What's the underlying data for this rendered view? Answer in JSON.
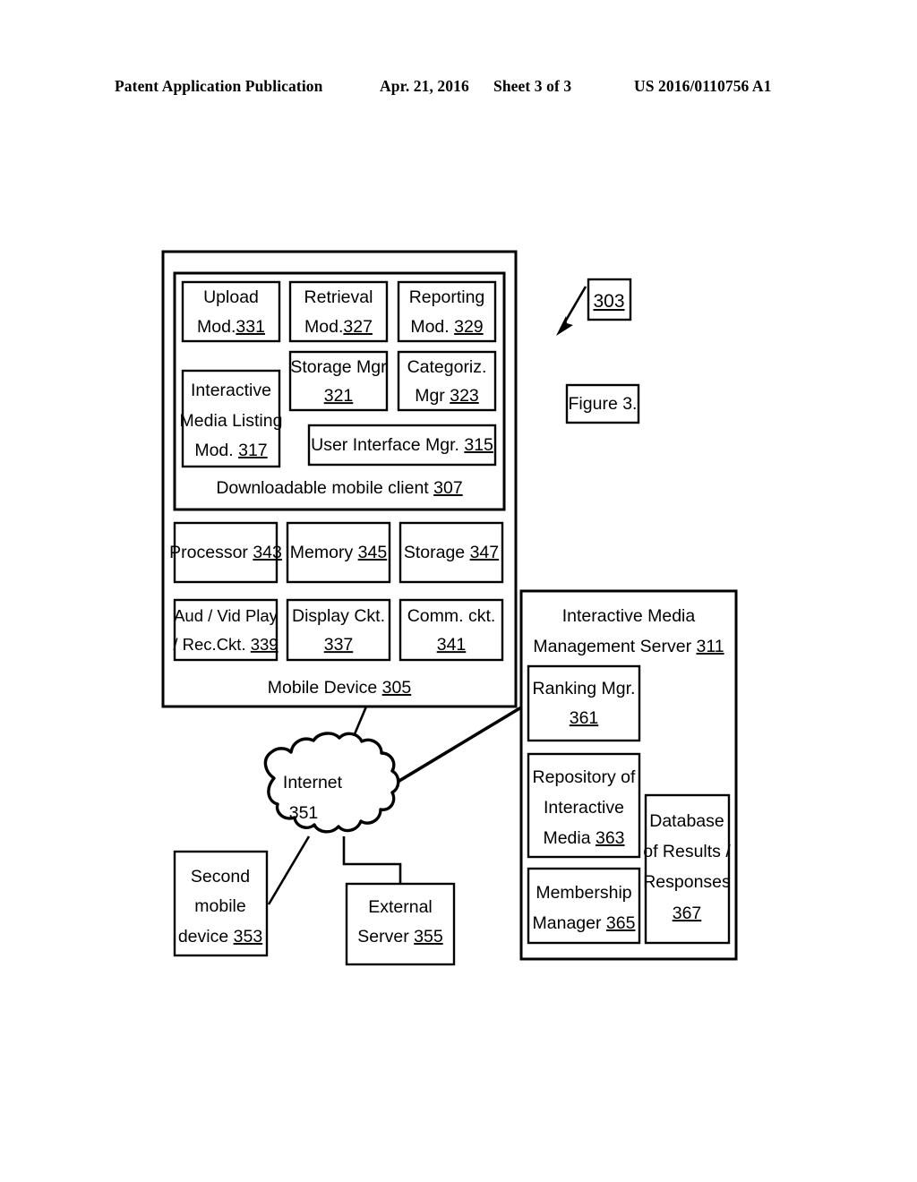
{
  "header": {
    "title": "Patent Application Publication",
    "date": "Apr. 21, 2016",
    "sheet": "Sheet 3 of 3",
    "number": "US 2016/0110756 A1"
  },
  "figure": {
    "reference_label": "303",
    "caption": "Figure 3."
  },
  "diagram": {
    "mobile_device": {
      "label_text": "Mobile Device",
      "label_num": "305",
      "client": {
        "label_text": "Downloadable mobile client",
        "label_num": "307",
        "modules": [
          {
            "line1": "Upload",
            "line2_text": "Mod.",
            "line2_num": "331"
          },
          {
            "line1": "Retrieval",
            "line2_text": "Mod.",
            "line2_num": "327"
          },
          {
            "line1": "Reporting",
            "line2_text": "Mod. ",
            "line2_num": "329"
          },
          {
            "line1": "Storage Mgr",
            "line2_text": "",
            "line2_num": "321"
          },
          {
            "line1": "Categoriz.",
            "line2_text": "Mgr ",
            "line2_num": "323"
          }
        ],
        "media_listing": {
          "line1": "Interactive",
          "line2": "Media Listing",
          "line3_text": "Mod. ",
          "line3_num": "317"
        },
        "user_interface_mgr": {
          "text": "User Interface Mgr. ",
          "num": "315"
        }
      },
      "hardware": [
        {
          "line1_text": "Processor ",
          "line1_num": "343",
          "line2_text": "",
          "line2_num": ""
        },
        {
          "line1_text": "Memory ",
          "line1_num": "345",
          "line2_text": "",
          "line2_num": ""
        },
        {
          "line1_text": "Storage ",
          "line1_num": "347",
          "line2_text": "",
          "line2_num": ""
        },
        {
          "line1_text": "Aud / Vid Play",
          "line1_num": "",
          "line2_text": "/ Rec.Ckt. ",
          "line2_num": "339"
        },
        {
          "line1_text": "Display Ckt.",
          "line1_num": "",
          "line2_text": "",
          "line2_num": "337"
        },
        {
          "line1_text": "Comm. ckt.",
          "line1_num": "",
          "line2_text": "",
          "line2_num": "341"
        }
      ]
    },
    "internet": {
      "line1": "Internet",
      "line2": "351"
    },
    "second_mobile_device": {
      "line1": "Second",
      "line2": "mobile",
      "line3_text": "device ",
      "line3_num": "353"
    },
    "external_server": {
      "line1": "External",
      "line2_text": "Server ",
      "line2_num": "355"
    },
    "management_server": {
      "line1": "Interactive Media",
      "line2_text": "Management Server ",
      "line2_num": "311",
      "components": [
        {
          "line1": "Ranking Mgr.",
          "line2": "",
          "line3": "",
          "num": "361"
        },
        {
          "line1": "Repository of",
          "line2": "Interactive",
          "line3_text": "Media  ",
          "num": "363"
        },
        {
          "line1": "Membership",
          "line2_text": "Manager ",
          "num": "365"
        },
        {
          "line1": "Database",
          "line2": "of Results /",
          "line3": "Responses",
          "num": "367"
        }
      ]
    }
  },
  "colors": {
    "ink": "#000000",
    "paper": "#ffffff"
  }
}
